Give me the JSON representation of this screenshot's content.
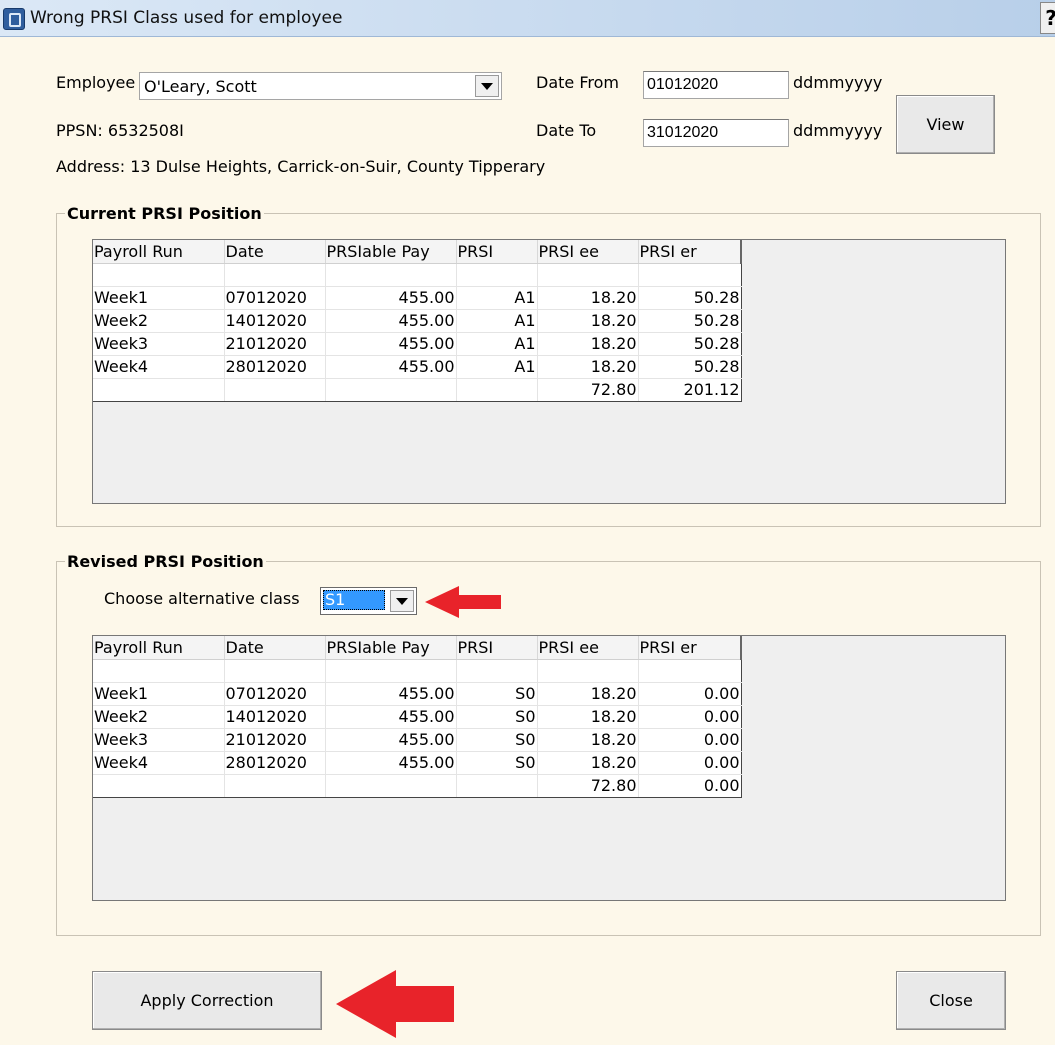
{
  "window": {
    "title": "Wrong PRSI Class used for employee",
    "help_glyph": "?"
  },
  "employee": {
    "label": "Employee",
    "selected": "O'Leary, Scott",
    "ppsn": "PPSN: 6532508I",
    "address": "Address: 13 Dulse Heights, Carrick-on-Suir, County Tipperary"
  },
  "dates": {
    "from_label": "Date From",
    "from_value": "01012020",
    "from_format": "ddmmyyyy",
    "to_label": "Date To",
    "to_value": "31012020",
    "to_format": "ddmmyyyy"
  },
  "buttons": {
    "view": "View",
    "apply": "Apply Correction",
    "close": "Close"
  },
  "current": {
    "title": "Current PRSI Position",
    "headers": [
      "Payroll Run",
      "Date",
      "PRSIable Pay",
      "PRSI",
      "PRSI ee",
      "PRSI er"
    ],
    "rows": [
      [
        "",
        "",
        "",
        "",
        "",
        ""
      ],
      [
        "Week1",
        "07012020",
        "455.00",
        "A1",
        "18.20",
        "50.28"
      ],
      [
        "Week2",
        "14012020",
        "455.00",
        "A1",
        "18.20",
        "50.28"
      ],
      [
        "Week3",
        "21012020",
        "455.00",
        "A1",
        "18.20",
        "50.28"
      ],
      [
        "Week4",
        "28012020",
        "455.00",
        "A1",
        "18.20",
        "50.28"
      ],
      [
        "",
        "",
        "",
        "",
        "72.80",
        "201.12"
      ]
    ]
  },
  "revised": {
    "title": "Revised PRSI Position",
    "choose_label": "Choose alternative class",
    "selected_class": "S1",
    "headers": [
      "Payroll Run",
      "Date",
      "PRSIable Pay",
      "PRSI",
      "PRSI ee",
      "PRSI er"
    ],
    "rows": [
      [
        "",
        "",
        "",
        "",
        "",
        ""
      ],
      [
        "Week1",
        "07012020",
        "455.00",
        "S0",
        "18.20",
        "0.00"
      ],
      [
        "Week2",
        "14012020",
        "455.00",
        "S0",
        "18.20",
        "0.00"
      ],
      [
        "Week3",
        "21012020",
        "455.00",
        "S0",
        "18.20",
        "0.00"
      ],
      [
        "Week4",
        "28012020",
        "455.00",
        "S0",
        "18.20",
        "0.00"
      ],
      [
        "",
        "",
        "",
        "",
        "72.80",
        "0.00"
      ]
    ]
  },
  "colors": {
    "background": "#fdf8ea",
    "arrow": "#e8232a",
    "selection": "#3399ff"
  },
  "annotations": [
    "red-arrow-icon",
    "red-arrow-icon"
  ]
}
